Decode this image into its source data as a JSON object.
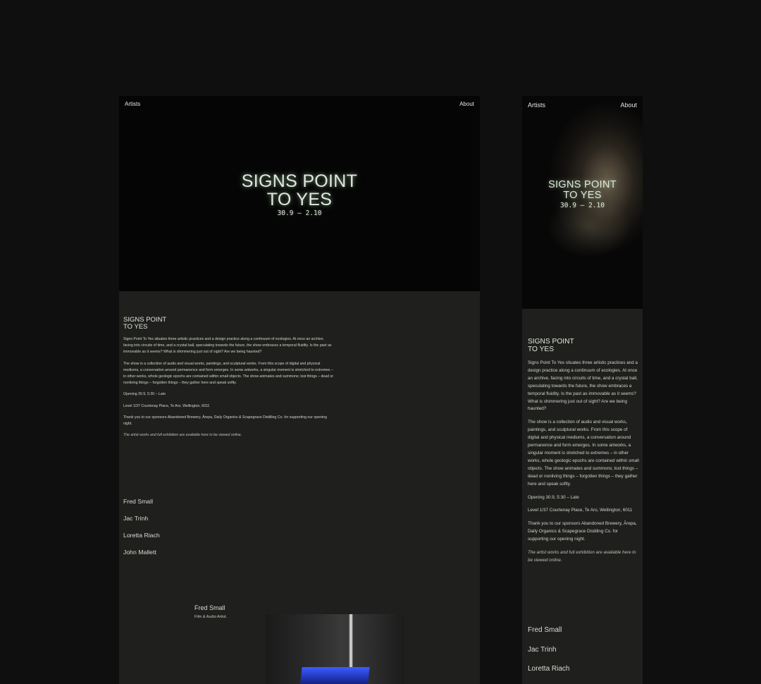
{
  "nav": {
    "artists": "Artists",
    "about": "About"
  },
  "hero": {
    "title_line1": "SIGNS POINT",
    "title_line2": "TO YES",
    "dates": "30.9 – 2.10"
  },
  "desktop": {
    "content": {
      "title_line1": "SIGNS POINT",
      "title_line2": "TO YES",
      "paragraph1": "Signs Point To Yes situates three artistic practices and a design practice along a continuum of ecologies. At once an archive, facing into circuits of time, and a crystal ball, speculating towards the future, the show embraces a temporal fluidity. Is the past as immovable as it seems? What is shimmering just out of sight? Are we being haunted?",
      "paragraph2": "The show is a collection of audio and visual works, paintings, and sculptural works. From this scope of digital and physical mediums, a conversation around permanence and form emerges. In some artworks, a singular moment is stretched to extremes – in other works, whole geologic epochs are contained within small objects. The show animates and summons; lost things – dead or nonliving things – forgotten things – they gather here and speak softly.",
      "opening": "Opening 30.9, 5:30 – Late",
      "address": "Level 1/37 Courtenay Place, Te Aro, Wellington, 6011",
      "thanks": "Thank you to our sponsors Abandoned Brewery, Ārepa, Daily Organics & Scapegrace Distilling Co. for supporting our opening night.",
      "note": "The artist works and full exhibition are available here to be viewed online."
    },
    "artists": [
      "Fred Small",
      "Jac Trinh",
      "Loretta Riach",
      "John Mallett"
    ],
    "feature": {
      "name": "Fred Small",
      "role": "Film & Audio Artist."
    }
  },
  "mobile": {
    "artists": [
      "Fred Small",
      "Jac Trinh",
      "Loretta Riach"
    ]
  },
  "colors": {
    "background": "#0f0f0f",
    "panel": "#1f201d",
    "hero": "#050505",
    "glow_text": "#dfe9dc"
  }
}
